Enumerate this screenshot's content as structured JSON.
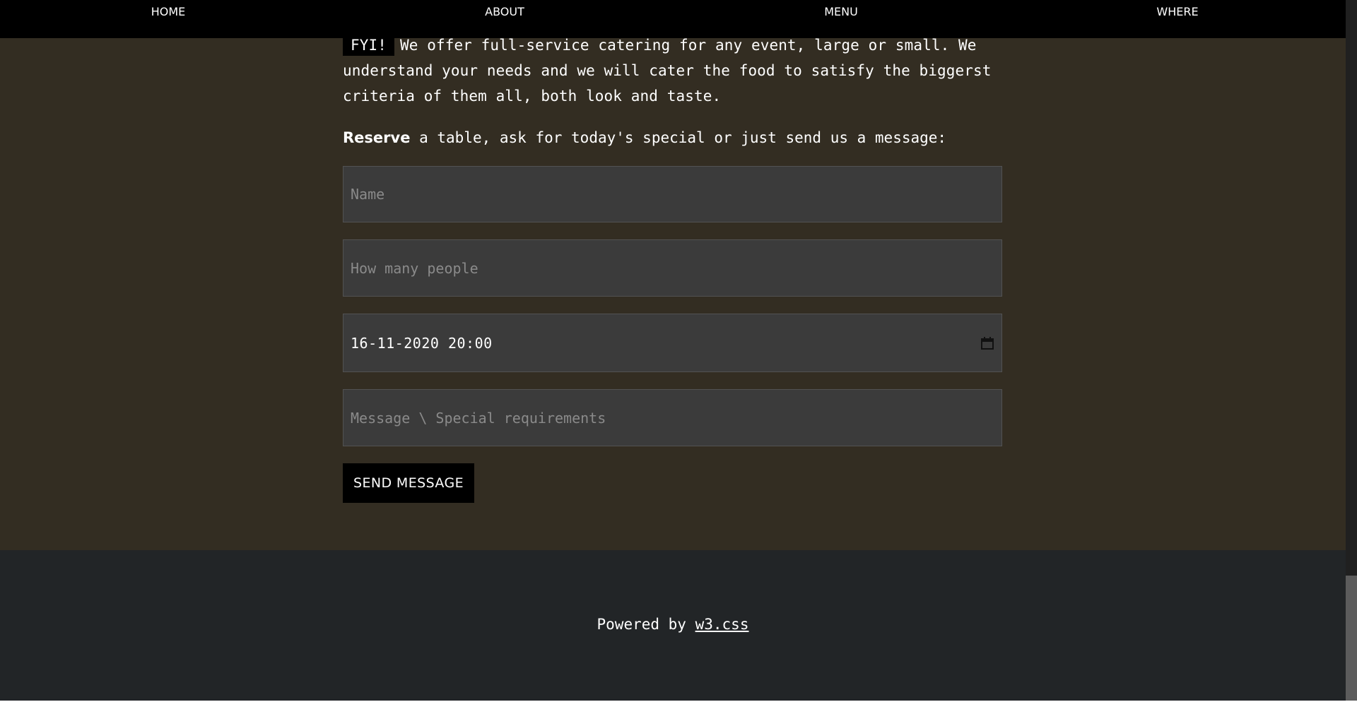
{
  "nav": {
    "items": [
      {
        "label": "HOME"
      },
      {
        "label": "ABOUT"
      },
      {
        "label": "MENU"
      },
      {
        "label": "WHERE"
      }
    ]
  },
  "catering": {
    "badge": "FYI!",
    "text": "We offer full-service catering for any event, large or small. We understand your needs and we will cater the food to satisfy the biggerst criteria of them all, both look and taste."
  },
  "reserve": {
    "bold": "Reserve",
    "text": "a table, ask for today's special or just send us a message:"
  },
  "form": {
    "name_placeholder": "Name",
    "people_placeholder": "How many people",
    "datetime_value": "16-11-2020 20:00",
    "message_placeholder": "Message \\ Special requirements",
    "send_label": "SEND MESSAGE"
  },
  "footer": {
    "prefix": "Powered by",
    "link": "w3.css"
  },
  "icons": {
    "datetime": "calendar-icon"
  },
  "colors": {
    "navbar": "#000000",
    "content_bg": "#332d22",
    "footer_bg": "#222527",
    "field_bg": "#3b3b3b",
    "button_bg": "#000000"
  }
}
